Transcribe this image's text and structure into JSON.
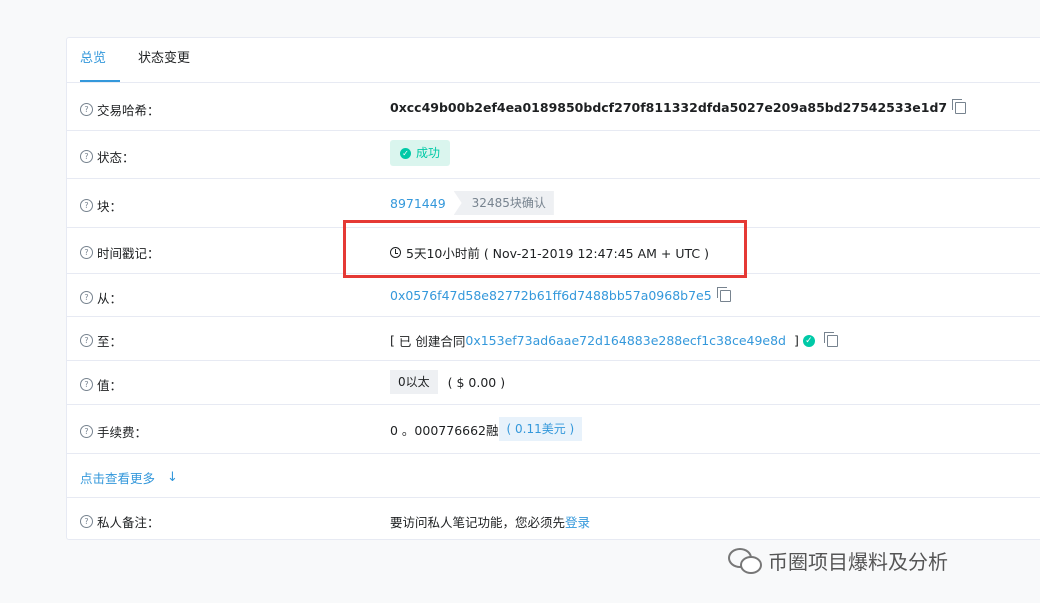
{
  "tabs": [
    {
      "label": "总览"
    },
    {
      "label": "状态变更"
    }
  ],
  "rows": {
    "hash": {
      "label": "交易哈希：",
      "value": "0xcc49b00b2ef4ea0189850bdcf270f811332dfda5027e209a85bd27542533e1d7"
    },
    "status": {
      "label": "状态：",
      "value": "成功"
    },
    "block": {
      "label": "块：",
      "value": "8971449",
      "confirmations": "32485块确认"
    },
    "timestamp": {
      "label": "时间戳记：",
      "value": "5天10小时前 ( Nov-21-2019 12:47:45 AM + UTC )"
    },
    "from": {
      "label": "从：",
      "value": "0x0576f47d58e82772b61ff6d7488bb57a0968b7e5"
    },
    "to": {
      "label": "至：",
      "prefix": "[",
      "contract_prefix": "已 创建合同",
      "contract": "0x153ef73ad6aae72d164883e288ecf1c38ce49e8d",
      "suffix": "]"
    },
    "value": {
      "label": "值：",
      "value": "0以太",
      "usd": "( $ 0.00 )"
    },
    "fee": {
      "label": "手续费：",
      "value": "0 。000776662融",
      "usd": "( 0.11美元 )"
    },
    "note": {
      "label": "私人备注：",
      "text": "要访问私人笔记功能，您必须先",
      "login": "登录"
    }
  },
  "more": {
    "label": "点击查看更多"
  },
  "watermark": {
    "text": "币圈项目爆料及分析"
  },
  "colors": {
    "accent": "#3498db",
    "success": "#00c9a7",
    "highlight": "#e53935"
  }
}
